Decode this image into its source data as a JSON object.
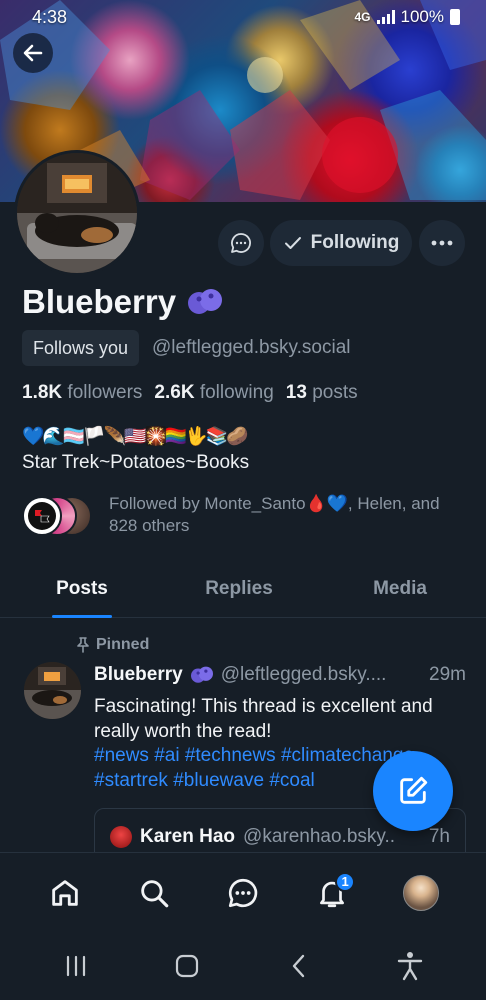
{
  "status_bar": {
    "time": "4:38",
    "network": "4G",
    "battery": "100%"
  },
  "profile": {
    "display_name": "Blueberry",
    "follows_you_label": "Follows you",
    "handle": "@leftlegged.bsky.social",
    "followers_count": "1.8K",
    "followers_label": "followers",
    "following_count": "2.6K",
    "following_label": "following",
    "posts_count": "13",
    "posts_label": "posts",
    "bio_emoji": "💙🌊🏳️‍⚧️🏳️🪶🇺🇸🎇🏳️‍🌈🖖📚🥔",
    "bio_text": "Star Trek~Potatoes~Books",
    "followed_by_text": "Followed by Monte_Santo🩸💙, Helen, and 828 others"
  },
  "actions": {
    "following_label": "Following"
  },
  "tabs": [
    {
      "label": "Posts",
      "active": true
    },
    {
      "label": "Replies",
      "active": false
    },
    {
      "label": "Media",
      "active": false
    }
  ],
  "post": {
    "pinned_label": "Pinned",
    "author": "Blueberry",
    "handle": "@leftlegged.bsky....",
    "time": "29m",
    "text": "Fascinating! This thread is excellent and really worth the read!",
    "tags": "#news #ai #technews #climatechange #startrek #bluewave #coal"
  },
  "quote": {
    "author": "Karen Hao",
    "handle": "@karenhao.bsky..",
    "time": "7h"
  },
  "bottom_nav": {
    "notifications_badge": "1"
  },
  "colors": {
    "accent": "#1a85ff",
    "background": "#161e27",
    "muted": "#8d98a4"
  }
}
